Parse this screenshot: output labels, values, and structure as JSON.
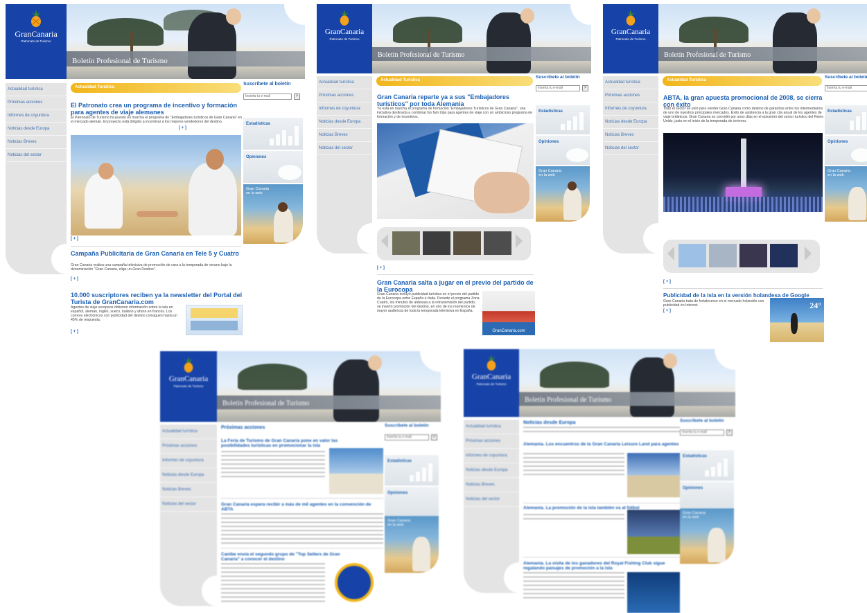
{
  "brand": {
    "logo_text": "GranCanaria",
    "logo_sub": "Patronato de Turismo",
    "header_title": "Boletín Profesional de Turismo"
  },
  "nav": {
    "items": [
      "Actualidad turística",
      "Próximas acciones",
      "Informes de coyuntura",
      "Noticias desde Europa",
      "Noticias Breves",
      "Noticias del sector"
    ]
  },
  "subscribe": {
    "title": "Suscríbete al boletín",
    "placeholder": "Inserta tu e-mail",
    "go": ">"
  },
  "right_boxes": {
    "stats": "Estadísticas",
    "opinions": "Opiniones",
    "web": "Gran Canaria en la web"
  },
  "more_link": "[ + ]",
  "shot1": {
    "band": "Actualidad Turística",
    "a1_title": "El Patronato crea un programa de incentivo y formación para agentes de viaje alemanes",
    "a1_body": "El Patronato de Turismo ha puesto en marcha el programa de \"Embajadores turísticos de Gran Canaria\" en el mercado alemán. El proyecto está dirigido a incentivar a los mejores vendedores del destino.",
    "a2_title": "Campaña Publicitaria de Gran Canaria en Tele 5 y Cuatro",
    "a2_body": "Gran Canaria realiza una campaña televisiva de promoción de cara a la temporada de verano bajo la denominación \"Gran Canaria, elige un Gran Destino\".",
    "a3_title": "10.000 suscriptores reciben ya la newsletter del Portal del Turista de GranCanaria.com",
    "a3_body": "Agentes de viaje europeos obtienen información sobre la isla en español, alemán, inglés, sueco, italiano y ahora en francés. Los correos electrónicos con publicidad del destino consiguen hasta un 45% de respuesta."
  },
  "shot2": {
    "band": "Actualidad Turística",
    "a1_title": "Gran Canaria reparte ya a sus \"Embajadores turísticos\" por toda Alemania",
    "a1_body": "Ya está en marcha el programa de formación \"Embajadores Turísticos de Gran Canaria\", una iniciativa destinada a combinar los fam trips para agentes de viaje con un ambicioso programa de formación y de incentivos.",
    "a2_title": "Gran Canaria salta a jugar en el previo del partido de la Eurocopa",
    "a2_body": "Gran Canaria incluyó publicidad turística en el previo del partido de la Eurocopa entre España e Italia. Durante el programa Zona Cuatro, los minutos de antesala a la retransmisión del partido, se insertó promoción del destino, en uno de los momentos de mayor audiencia de toda la temporada televisiva en España.",
    "promo_text": "GranCanaria.com"
  },
  "shot3": {
    "band": "Actualidad Turística",
    "a1_title": "ABTA, la gran apuesta promocional de 2008, se cierra con éxito",
    "a1_body": "Todo el sector se unió para vender Gran Canaria como destino de garantías entre los intermediarios de uno de nuestros principales mercados. Éxito de asistencia a la gran cita anual de los agentes de viaje británicos. Gran Canaria se convirtió por unos días en el epicentro del sector turístico del Reino Unido, justo en el inicio de la temporada de invierno.",
    "a2_title": "Publicidad de la isla en la versión holandesa de Google",
    "a2_body": "Gran Canaria trata de fortalecerse en el mercado holandés con publicidad en Internet.",
    "temp": "24°"
  },
  "shot4": {
    "band": "Próximas acciones",
    "a1_title": "La Feria de Turismo de Gran Canaria pone en valor las posibilidades turísticas en promocionar la isla",
    "a2_title": "Gran Canaria espera recibir a más de mil agentes en la convención de ABTA",
    "a3_title": "Canibe envía el segundo grupo de \"Top Sellers de Gran Canaria\" a conocer el destino"
  },
  "shot5": {
    "band": "Noticias desde Europa",
    "a1_title": "Alemania. Los encuentros de la Gran Canaria Leisure Land para agentes",
    "a2_title": "Alemania. La promoción de la isla también va al fútbol",
    "a3_title": "Alemania. La visita de los ganadores del Royal Fishing Club sigue regalando paisajes de promoción a la isla"
  }
}
